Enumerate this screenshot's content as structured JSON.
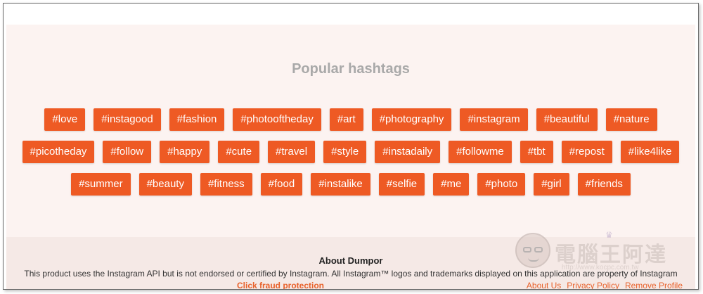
{
  "section": {
    "title": "Popular hashtags"
  },
  "hashtag_rows": [
    [
      "#love",
      "#instagood",
      "#fashion",
      "#photooftheday",
      "#art",
      "#photography",
      "#instagram",
      "#beautiful",
      "#nature"
    ],
    [
      "#picotheday",
      "#follow",
      "#happy",
      "#cute",
      "#travel",
      "#style",
      "#instadaily",
      "#followme",
      "#tbt",
      "#repost",
      "#like4like"
    ],
    [
      "#summer",
      "#beauty",
      "#fitness",
      "#food",
      "#instalike",
      "#selfie",
      "#me",
      "#photo",
      "#girl",
      "#friends"
    ]
  ],
  "footer": {
    "heading": "About Dumpor",
    "disclaimer": "This product uses the Instagram API but is not endorsed or certified by Instagram. All Instagram™ logos and trademarks displayed on this application are property of Instagram",
    "fraud_link": "Click fraud protection",
    "links": [
      "About Us",
      "Privacy Policy",
      "Remove Profile"
    ]
  },
  "watermark": {
    "text": "電腦王阿達",
    "url": "http://www.kocpc.com.tw"
  },
  "colors": {
    "tag_bg": "#ee5a24",
    "tag_text": "#ffffff",
    "page_bg": "#fcf3f1",
    "footer_bg": "#f5e9e6",
    "title_text": "#a9a9a9",
    "link": "#e8622c"
  }
}
